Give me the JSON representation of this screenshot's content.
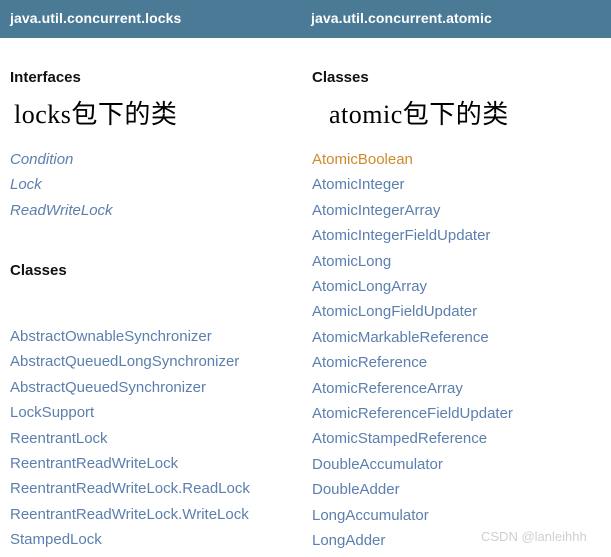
{
  "header": {
    "background_color": "#4a7a96",
    "packages": [
      {
        "name": "java.util.concurrent.locks"
      },
      {
        "name": "java.util.concurrent.atomic"
      }
    ]
  },
  "colors": {
    "link": "#5b7fae",
    "visited_link": "#cf8a2c",
    "heading": "#111111",
    "caption": "#000000",
    "watermark": "#cfcfcf"
  },
  "columns": [
    {
      "id": "locks",
      "package": "java.util.concurrent.locks",
      "caption": "locks包下的类",
      "sections": [
        {
          "heading": "Interfaces",
          "style": "italic",
          "items": [
            "Condition",
            "Lock",
            "ReadWriteLock"
          ]
        },
        {
          "heading": "Classes",
          "style": "normal",
          "items": [
            "AbstractOwnableSynchronizer",
            "AbstractQueuedLongSynchronizer",
            "AbstractQueuedSynchronizer",
            "LockSupport",
            "ReentrantLock",
            "ReentrantReadWriteLock",
            "ReentrantReadWriteLock.ReadLock",
            "ReentrantReadWriteLock.WriteLock",
            "StampedLock"
          ]
        }
      ]
    },
    {
      "id": "atomic",
      "package": "java.util.concurrent.atomic",
      "caption": "atomic包下的类",
      "sections": [
        {
          "heading": "Classes",
          "style": "normal",
          "items": [
            "AtomicBoolean",
            "AtomicInteger",
            "AtomicIntegerArray",
            "AtomicIntegerFieldUpdater",
            "AtomicLong",
            "AtomicLongArray",
            "AtomicLongFieldUpdater",
            "AtomicMarkableReference",
            "AtomicReference",
            "AtomicReferenceArray",
            "AtomicReferenceFieldUpdater",
            "AtomicStampedReference",
            "DoubleAccumulator",
            "DoubleAdder",
            "LongAccumulator",
            "LongAdder"
          ],
          "visited_items": [
            "AtomicBoolean"
          ]
        }
      ]
    }
  ],
  "watermark": {
    "text": "CSDN @lanleihhh"
  }
}
